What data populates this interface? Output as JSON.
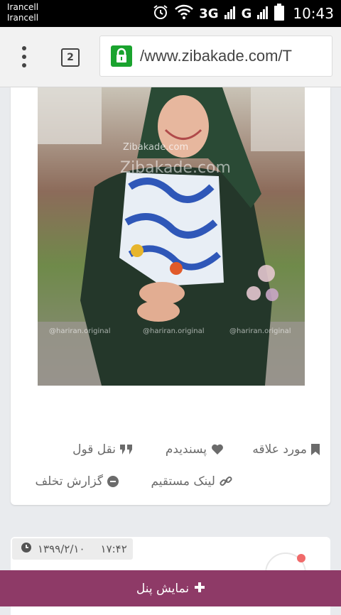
{
  "status_bar": {
    "carrier_1": "Irancell",
    "carrier_2": "Irancell",
    "network_1": "3G",
    "network_2": "G",
    "time": "10:43"
  },
  "browser": {
    "tab_count": "2",
    "url": "/www.zibakade.com/T"
  },
  "post": {
    "image_watermark": "Zibakade.com",
    "image_credit": "@hariran.original",
    "actions": {
      "bookmark": "مورد علاقه",
      "like": "پسندیدم",
      "quote": "نقل قول",
      "direct_link": "لینک مستقیم",
      "report": "گزارش تخلف"
    }
  },
  "next_post": {
    "date": "۱۳۹۹/۲/۱۰",
    "time": "۱۷:۴۲"
  },
  "bottom_bar": {
    "label": "نمایش پنل"
  },
  "colors": {
    "secure_green": "#1aa32e",
    "panel_bar": "#8e3a67",
    "action_text": "#6b6b6b"
  }
}
